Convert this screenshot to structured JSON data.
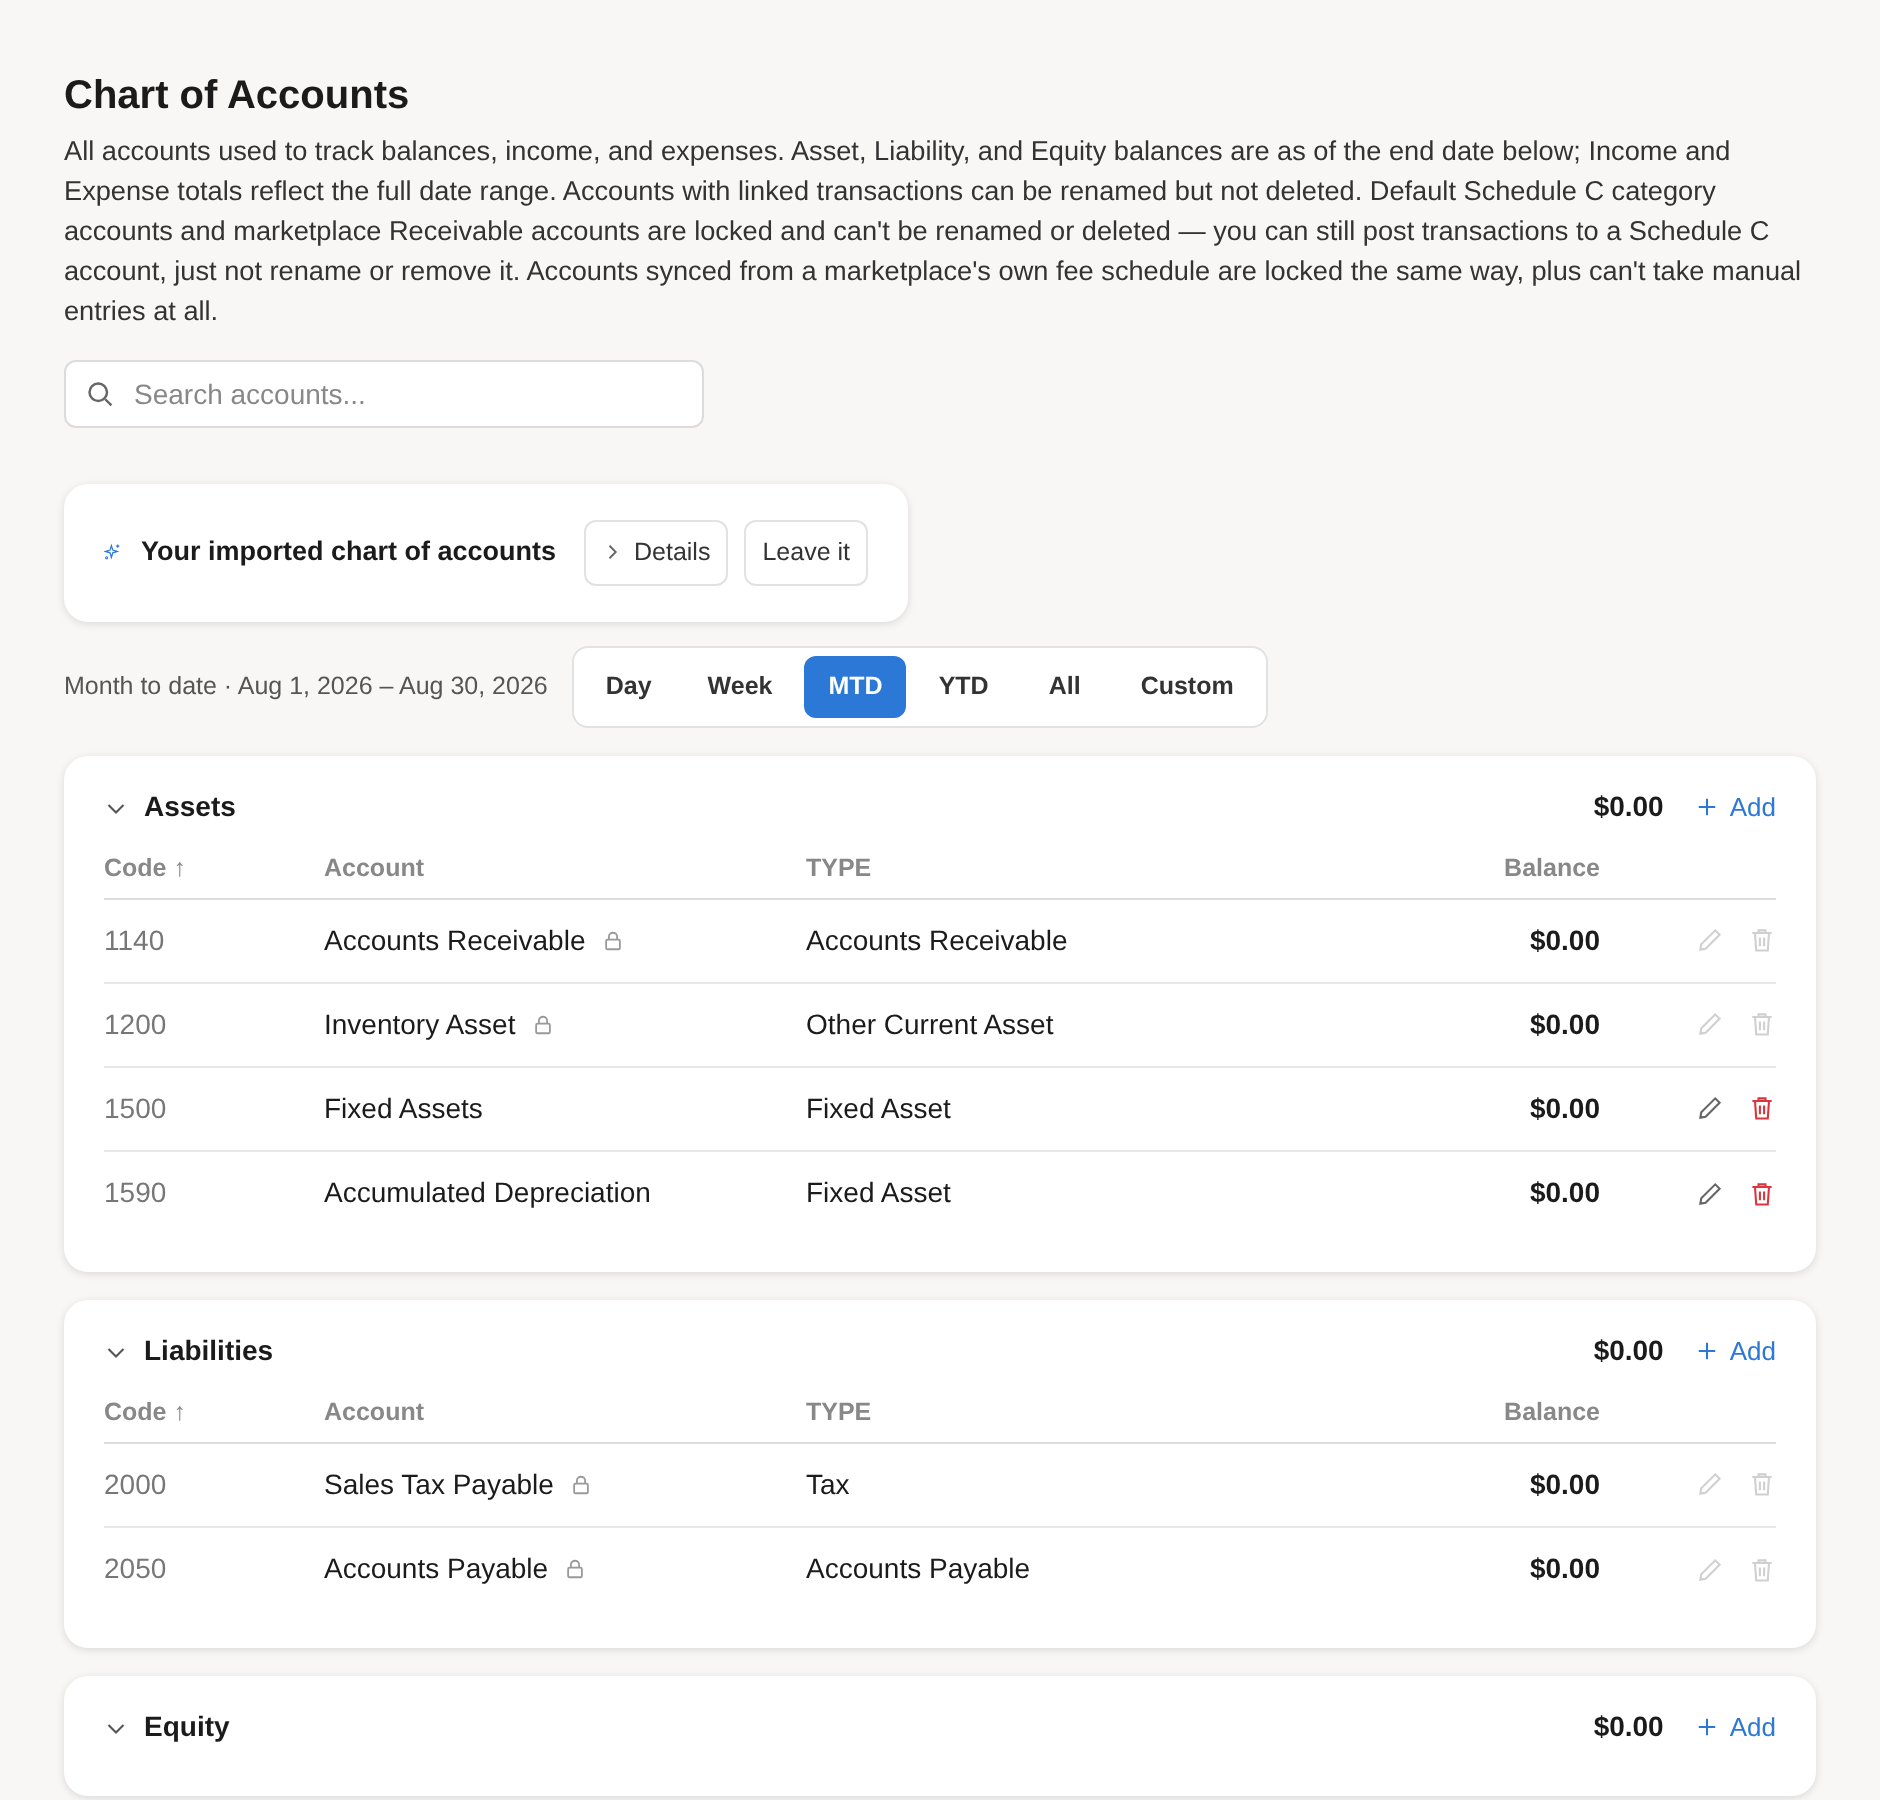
{
  "page": {
    "title": "Chart of Accounts",
    "description": "All accounts used to track balances, income, and expenses. Asset, Liability, and Equity balances are as of the end date below; Income and Expense totals reflect the full date range. Accounts with linked transactions can be renamed but not deleted. Default Schedule C category accounts and marketplace Receivable accounts are locked and can't be renamed or deleted — you can still post transactions to a Schedule C account, just not rename or remove it. Accounts synced from a marketplace's own fee schedule are locked the same way, plus can't take manual entries at all."
  },
  "search": {
    "placeholder": "Search accounts..."
  },
  "import_banner": {
    "title": "Your imported chart of accounts",
    "buttons": [
      {
        "label": "Details",
        "kind": "expand"
      },
      {
        "label": "Leave it",
        "kind": "plain"
      }
    ]
  },
  "date_range": {
    "label": "Month to date · Aug 1, 2026 – Aug 30, 2026",
    "periods": [
      {
        "label": "Day",
        "selected": false
      },
      {
        "label": "Week",
        "selected": false
      },
      {
        "label": "MTD",
        "selected": true
      },
      {
        "label": "YTD",
        "selected": false
      },
      {
        "label": "All",
        "selected": false
      },
      {
        "label": "Custom",
        "selected": false
      }
    ]
  },
  "sections": [
    {
      "name": "Assets",
      "expanded": true,
      "total": "$0.00",
      "add_label": "Add",
      "columns": [
        "Code ↑",
        "Account",
        "TYPE",
        "Balance"
      ],
      "rows": [
        {
          "code": "1140",
          "account": "Accounts Receivable",
          "locked": true,
          "type": "Accounts Receivable",
          "balance": "$0.00"
        },
        {
          "code": "1200",
          "account": "Inventory Asset",
          "locked": true,
          "type": "Other Current Asset",
          "balance": "$0.00"
        },
        {
          "code": "1500",
          "account": "Fixed Assets",
          "locked": false,
          "type": "Fixed Asset",
          "balance": "$0.00"
        },
        {
          "code": "1590",
          "account": "Accumulated Depreciation",
          "locked": false,
          "type": "Fixed Asset",
          "balance": "$0.00"
        }
      ]
    },
    {
      "name": "Liabilities",
      "expanded": true,
      "total": "$0.00",
      "add_label": "Add",
      "columns": [
        "Code ↑",
        "Account",
        "TYPE",
        "Balance"
      ],
      "rows": [
        {
          "code": "2000",
          "account": "Sales Tax Payable",
          "locked": true,
          "type": "Tax",
          "balance": "$0.00"
        },
        {
          "code": "2050",
          "account": "Accounts Payable",
          "locked": true,
          "type": "Accounts Payable",
          "balance": "$0.00"
        }
      ]
    },
    {
      "name": "Equity",
      "expanded": true,
      "total": "$0.00",
      "add_label": "Add"
    }
  ]
}
